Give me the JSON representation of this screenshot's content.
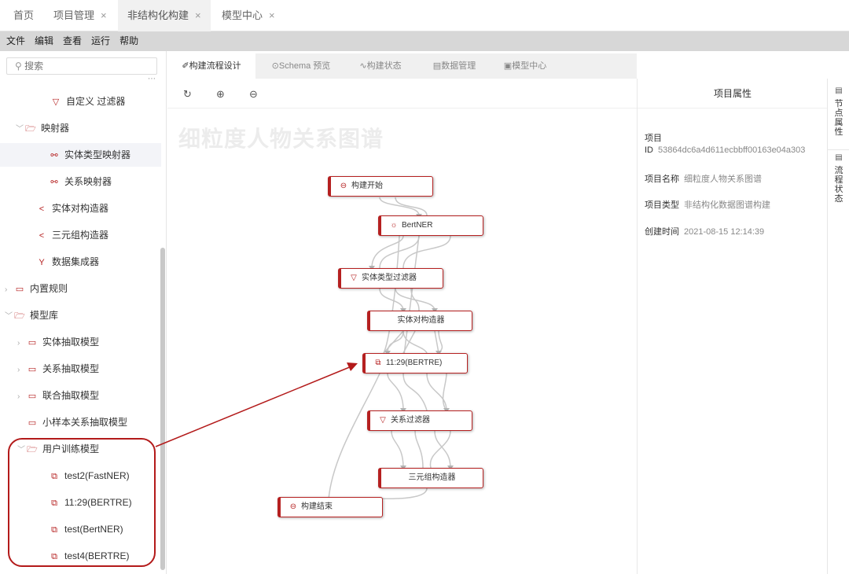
{
  "top_tabs": [
    {
      "label": "首页",
      "closable": false
    },
    {
      "label": "项目管理",
      "closable": true
    },
    {
      "label": "非结构化构建",
      "closable": true,
      "active": true
    },
    {
      "label": "模型中心",
      "closable": true
    }
  ],
  "close_glyph": "×",
  "menu": [
    "文件",
    "编辑",
    "查看",
    "运行",
    "帮助"
  ],
  "search": {
    "placeholder": "搜索"
  },
  "tree": [
    {
      "label": "自定义 过滤器",
      "icon": "filter-icon"
    },
    {
      "label": "映射器",
      "icon": "folder-open-icon"
    },
    {
      "label": "实体类型映射器",
      "icon": "link-icon",
      "selected": true
    },
    {
      "label": "关系映射器",
      "icon": "link-icon"
    },
    {
      "label": "实体对构造器",
      "icon": "share-icon"
    },
    {
      "label": "三元组构造器",
      "icon": "share-icon"
    },
    {
      "label": "数据集成器",
      "icon": "merge-icon"
    },
    {
      "label": "内置规则",
      "icon": "folder-icon"
    },
    {
      "label": "模型库",
      "icon": "folder-open-icon"
    },
    {
      "label": "实体抽取模型",
      "icon": "folder-icon"
    },
    {
      "label": "关系抽取模型",
      "icon": "folder-icon"
    },
    {
      "label": "联合抽取模型",
      "icon": "folder-icon"
    },
    {
      "label": "小样本关系抽取模型",
      "icon": "folder-icon"
    },
    {
      "label": "用户训练模型",
      "icon": "folder-open-icon"
    },
    {
      "label": "test2(FastNER)",
      "icon": "model-icon"
    },
    {
      "label": "11:29(BERTRE)",
      "icon": "model-icon"
    },
    {
      "label": "test(BertNER)",
      "icon": "model-icon"
    },
    {
      "label": "test4(BERTRE)",
      "icon": "model-icon"
    }
  ],
  "center_tabs": [
    "构建流程设计",
    "Schema 预览",
    "构建状态",
    "数据管理",
    "模型中心"
  ],
  "watermark": "细粒度人物关系图谱",
  "nodes": [
    {
      "label": "构建开始",
      "icon": "start-icon"
    },
    {
      "label": "BertNER",
      "icon": "gear-icon"
    },
    {
      "label": "实体类型过滤器",
      "icon": "filter-icon"
    },
    {
      "label": "实体对构造器",
      "icon": ""
    },
    {
      "label": "11:29(BERTRE)",
      "icon": "model-icon"
    },
    {
      "label": "关系过滤器",
      "icon": "filter-icon"
    },
    {
      "label": "三元组构造器",
      "icon": ""
    },
    {
      "label": "构建结束",
      "icon": "end-icon"
    }
  ],
  "right_panel": {
    "title": "项目属性",
    "project_label": "项目",
    "id_label": "ID",
    "id_value": "53864dc6a4d611ecbbff00163e04a303",
    "name_label": "项目名称",
    "name_value": "细粒度人物关系图谱",
    "type_label": "项目类型",
    "type_value": "非结构化数据图谱构建",
    "created_label": "创建时间",
    "created_value": "2021-08-15 12:14:39"
  },
  "side_tabs": [
    "节点属性",
    "流程状态"
  ],
  "colors": {
    "accent": "#b52020",
    "menubar": "#d7d7d7"
  }
}
